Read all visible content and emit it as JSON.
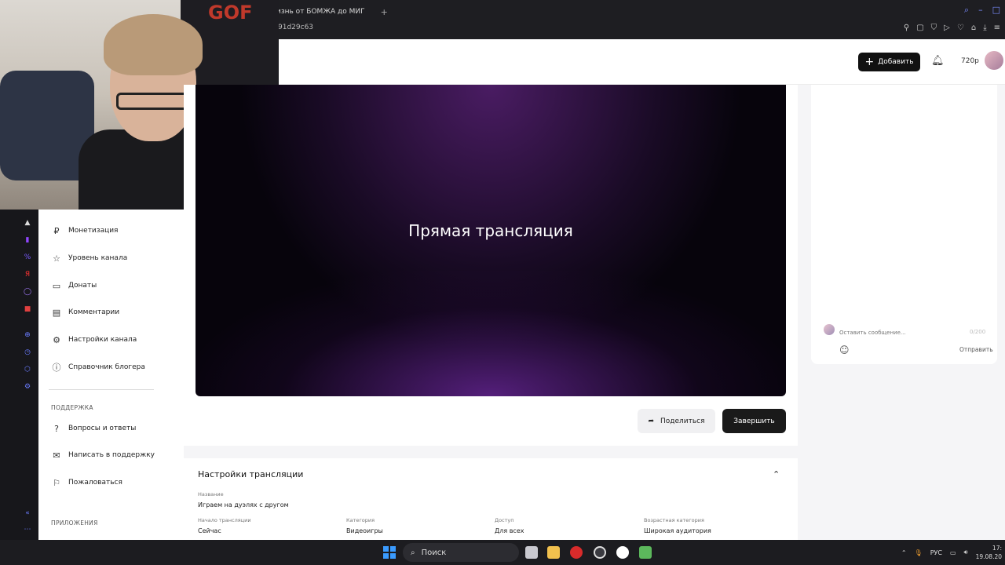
{
  "browser": {
    "tab_title": "изнь от БОМЖА до МИГ",
    "new_tab_symbol": "+",
    "url_fragment": "91d29c63"
  },
  "header": {
    "add_button": "Добавить",
    "quality": "720p"
  },
  "webcam": {
    "chair_logo": "GOF"
  },
  "sidebar": {
    "items": [
      {
        "label": "Монетизация",
        "icon": "ruble-icon"
      },
      {
        "label": "Уровень канала",
        "icon": "star-icon"
      },
      {
        "label": "Донаты",
        "icon": "wallet-icon"
      },
      {
        "label": "Комментарии",
        "icon": "comment-icon"
      },
      {
        "label": "Настройки канала",
        "icon": "gear-icon"
      },
      {
        "label": "Справочник блогера",
        "icon": "info-icon"
      }
    ],
    "support_title": "ПОДДЕРЖКА",
    "support_items": [
      {
        "label": "Вопросы и ответы",
        "icon": "question-icon"
      },
      {
        "label": "Написать в поддержку",
        "icon": "mail-icon"
      },
      {
        "label": "Пожаловаться",
        "icon": "flag-icon"
      }
    ],
    "apps_title": "ПРИЛОЖЕНИЯ"
  },
  "player": {
    "status_title": "Прямая трансляция"
  },
  "actions": {
    "share": "Поделиться",
    "finish": "Завершить"
  },
  "chat": {
    "placeholder": "Оставить сообщение...",
    "counter": "0/200",
    "send": "Отправить"
  },
  "settings": {
    "title": "Настройки трансляции",
    "name_label": "Название",
    "name_value": "Играем на дуэлях с другом",
    "start_label": "Начало трансляции",
    "start_value": "Сейчас",
    "category_label": "Категория",
    "category_value": "Видеоигры",
    "access_label": "Доступ",
    "access_value": "Для всех",
    "age_label": "Возрастная категория",
    "age_value": "Широкая аудитория"
  },
  "taskbar": {
    "search_label": "Поиск",
    "language": "РУС",
    "time": "17:",
    "date": "19.08.20"
  },
  "colors": {
    "brand_dark": "#111111",
    "rail_bg": "#17171b",
    "player_purple": "#4a1c63"
  }
}
